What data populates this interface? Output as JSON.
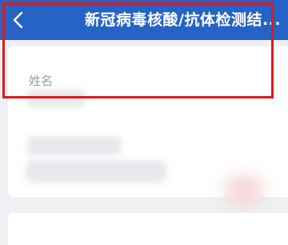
{
  "header": {
    "title": "新冠病毒核酸/抗体检测结...",
    "back_icon": "chevron-left-icon",
    "background_color": "#2563c6"
  },
  "record": {
    "name_label": "姓名"
  },
  "annotation": {
    "highlight_color": "#e01818"
  }
}
